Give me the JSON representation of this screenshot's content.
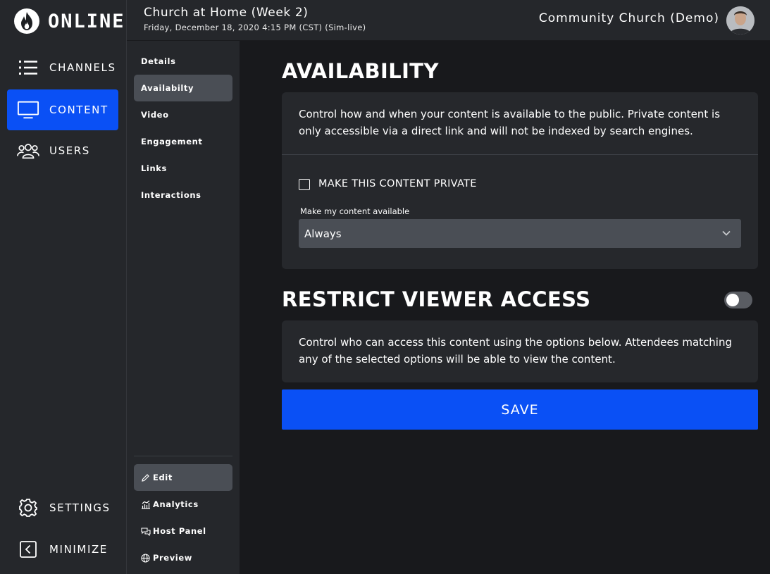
{
  "app": {
    "logo_text": "ONLINE"
  },
  "leftnav": {
    "items": [
      {
        "label": "CHANNELS",
        "icon": "list-icon"
      },
      {
        "label": "CONTENT",
        "icon": "monitor-icon",
        "active": true
      },
      {
        "label": "USERS",
        "icon": "users-icon"
      }
    ],
    "bottom": [
      {
        "label": "SETTINGS",
        "icon": "gear-icon"
      },
      {
        "label": "MINIMIZE",
        "icon": "collapse-icon"
      }
    ]
  },
  "header": {
    "title": "Church at Home (Week 2)",
    "datetime": "Friday, December 18, 2020 4:15 PM (CST) (Sim-live)",
    "org": "Community Church (Demo)"
  },
  "subnav": {
    "items": [
      {
        "label": "Details"
      },
      {
        "label": "Availabilty",
        "active": true
      },
      {
        "label": "Video"
      },
      {
        "label": "Engagement"
      },
      {
        "label": "Links"
      },
      {
        "label": "Interactions"
      }
    ],
    "bottom": [
      {
        "label": "Edit",
        "icon": "pencil-icon",
        "active": true
      },
      {
        "label": "Analytics",
        "icon": "chart-icon"
      },
      {
        "label": "Host Panel",
        "icon": "chat-icon"
      },
      {
        "label": "Preview",
        "icon": "globe-icon"
      }
    ]
  },
  "availability": {
    "title": "AVAILABILITY",
    "description": "Control how and when your content is available to the public. Private content is only accessible via a direct link and will not be indexed by search engines.",
    "private_label": "MAKE THIS CONTENT PRIVATE",
    "private_checked": false,
    "field_label": "Make my content available",
    "selected": "Always"
  },
  "restrict": {
    "title": "RESTRICT VIEWER ACCESS",
    "enabled": false,
    "description": "Control who can access this content using the options below. Attendees matching any of the selected options will be able to view the content."
  },
  "save_label": "SAVE",
  "colors": {
    "accent": "#0a50f5",
    "sidebar": "#25272b",
    "background": "#18191c",
    "card": "#26282c"
  }
}
